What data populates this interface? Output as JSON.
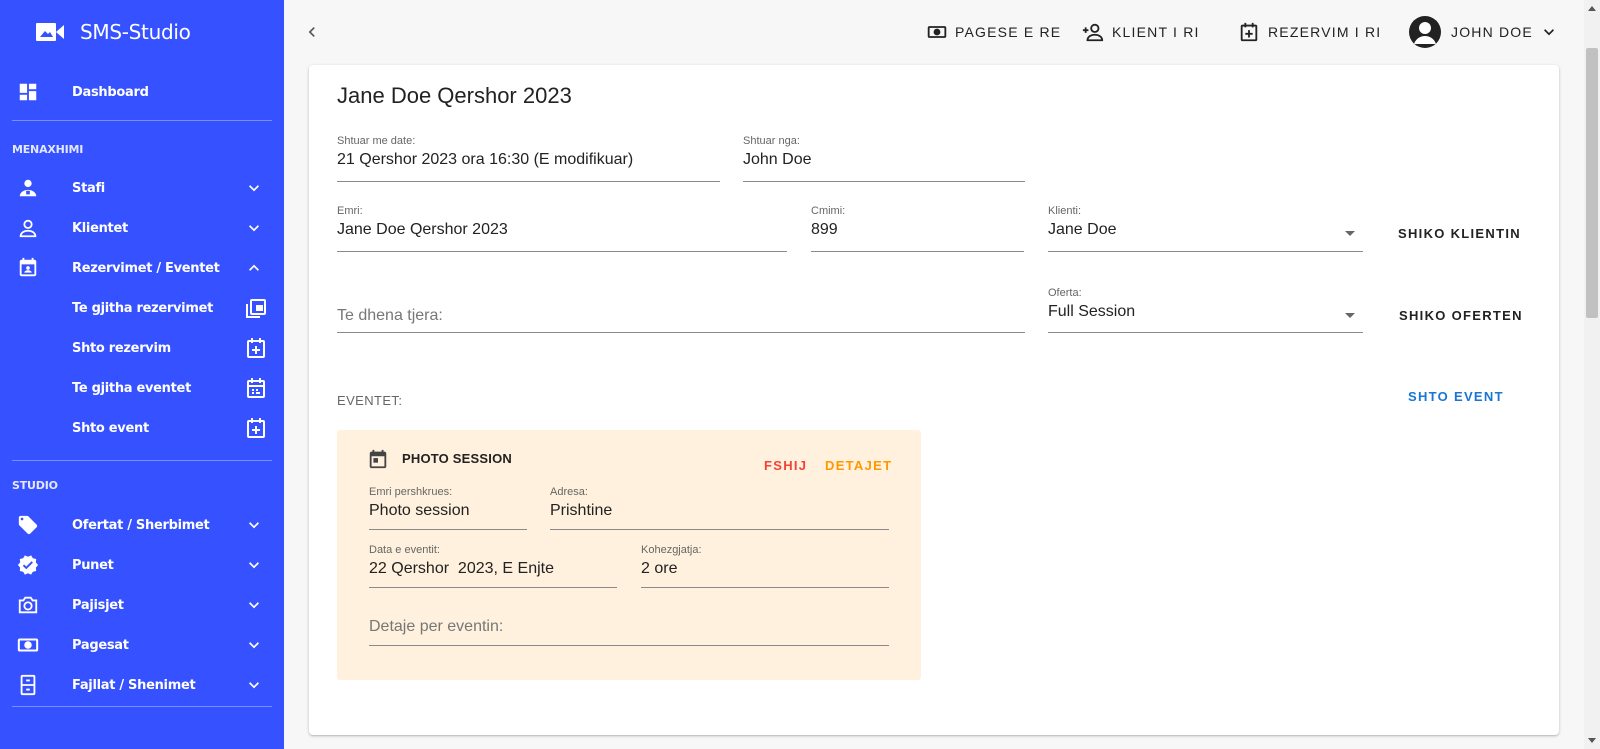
{
  "app": {
    "title": "SMS-Studio"
  },
  "colors": {
    "sidebar": "#3651ff",
    "link_blue": "#1976d2",
    "danger": "#f44336",
    "warning": "#ff9800",
    "event_bg": "#fff1dd"
  },
  "sidebar": {
    "dashboard": "Dashboard",
    "section_menaxhimi": "MENAXHIMI",
    "stafi": "Stafi",
    "klientet": "Klientet",
    "rezervimet": "Rezervimet / Eventet",
    "sub": {
      "te_gjitha_rezervimet": "Te gjitha rezervimet",
      "shto_rezervim": "Shto rezervim",
      "te_gjitha_eventet": "Te gjitha eventet",
      "shto_event": "Shto event"
    },
    "section_studio": "STUDIO",
    "ofertat": "Ofertat / Sherbimet",
    "punet": "Punet",
    "pajisjet": "Pajisjet",
    "pagesat": "Pagesat",
    "fajllat": "Fajllat / Shenimet"
  },
  "topbar": {
    "pagese": "PAGESE E RE",
    "klient": "KLIENT I RI",
    "rezervim": "REZERVIM I RI",
    "user": "JOHN DOE"
  },
  "booking": {
    "title": "Jane Doe Qershor 2023",
    "shtuar_me_date_label": "Shtuar me date:",
    "shtuar_me_date": "21 Qershor 2023 ora 16:30 (E modifikuar)",
    "shtuar_nga_label": "Shtuar nga:",
    "shtuar_nga": "John Doe",
    "emri_label": "Emri:",
    "emri": "Jane Doe Qershor 2023",
    "cmimi_label": "Cmimi:",
    "cmimi": "899",
    "klienti_label": "Klienti:",
    "klienti": "Jane Doe",
    "shiko_klientin": "SHIKO KLIENTIN",
    "te_dhena_placeholder": "Te dhena tjera:",
    "oferta_label": "Oferta:",
    "oferta": "Full Session",
    "shiko_oferten": "SHIKO OFERTEN",
    "eventet_label": "EVENTET:",
    "shto_event": "SHTO EVENT"
  },
  "event": {
    "title": "PHOTO SESSION",
    "fshij": "FSHIJ",
    "detajet": "DETAJET",
    "emri_label": "Emri pershkrues:",
    "emri": "Photo session",
    "adresa_label": "Adresa:",
    "adresa": "Prishtine",
    "data_label": "Data e eventit:",
    "data": "22 Qershor  2023, E Enjte",
    "kohezgjatja_label": "Kohezgjatja:",
    "kohezgjatja": "2 ore",
    "detaje_placeholder": "Detaje per eventin:"
  }
}
